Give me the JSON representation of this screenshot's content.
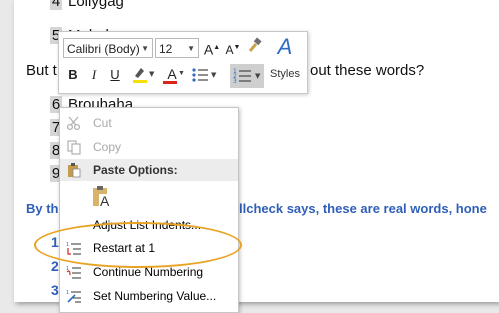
{
  "document": {
    "line_top": {
      "number": "4",
      "text": "Lollygag"
    },
    "line_2": {
      "number": "5",
      "text": "Malarkey"
    },
    "but_line": {
      "start": "But t",
      "end": "out these words?"
    },
    "list_items": [
      {
        "number": "6",
        "text": "Brouhaha"
      },
      {
        "number": "7",
        "text": ""
      },
      {
        "number": "8",
        "text": ""
      },
      {
        "number": "9",
        "text": ""
      }
    ],
    "blue_start": "By th",
    "blue_end": "llcheck says, these are real words, hone",
    "blue_numbers": [
      "1",
      "2",
      "3"
    ]
  },
  "mini_toolbar": {
    "font_name": "Calibri (Body)",
    "font_size": "12",
    "grow_font": "A",
    "shrink_font": "A",
    "bold": "B",
    "italic": "I",
    "underline": "U",
    "font_color": "A",
    "styles_label": "Styles",
    "styles_glyph": "A"
  },
  "context_menu": {
    "items": [
      {
        "label": "Cut",
        "icon": "scissors-icon",
        "enabled": false
      },
      {
        "label": "Copy",
        "icon": "copy-icon",
        "enabled": false
      },
      {
        "label": "Paste Options:",
        "icon": "paste-icon",
        "header": true
      },
      {
        "label": "Adjust List Indents...",
        "icon": "",
        "enabled": true
      },
      {
        "label": "Restart at 1",
        "icon": "restart-numbering-icon",
        "enabled": true,
        "highlighted": true
      },
      {
        "label": "Continue Numbering",
        "icon": "continue-numbering-icon",
        "enabled": true
      },
      {
        "label": "Set Numbering Value...",
        "icon": "set-numbering-value-icon",
        "enabled": true
      }
    ],
    "paste_keep_text_glyph": "A"
  },
  "colors": {
    "highlight_oval": "#e8a323",
    "blue_text": "#2f5fb8",
    "font_color_bar": "#d9261c",
    "highlight_bar": "#f6e000"
  }
}
